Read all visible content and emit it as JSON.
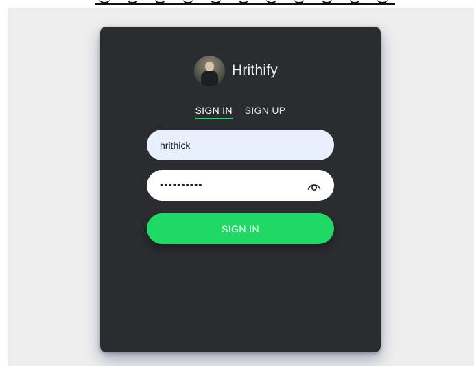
{
  "brand": {
    "name": "Hrithify",
    "avatar_icon": "user-avatar-photo"
  },
  "tabs": [
    {
      "label": "SIGN IN",
      "active": true
    },
    {
      "label": "SIGN UP",
      "active": false
    }
  ],
  "form": {
    "username_value": "hrithick",
    "password_value": "••••••••••",
    "password_toggle_icon": "eye-icon",
    "submit_label": "SIGN IN"
  },
  "colors": {
    "accent": "#1fd865",
    "card_background": "#2b2c2f",
    "page_background": "#eeeeee",
    "username_field_background": "#e8effd"
  }
}
